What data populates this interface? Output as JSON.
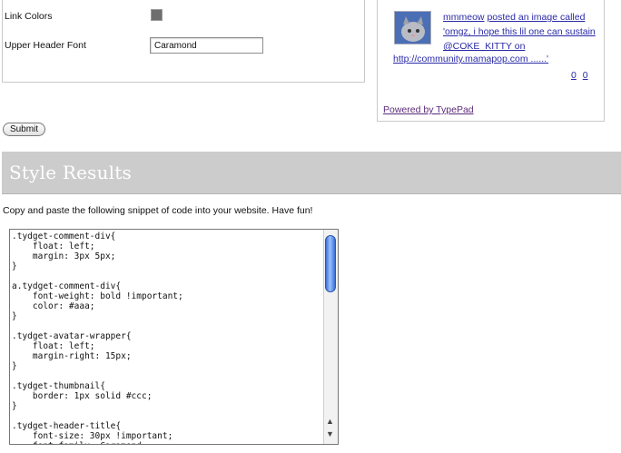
{
  "form": {
    "link_colors_label": "Link Colors",
    "upper_header_font_label": "Upper Header Font",
    "upper_header_font_value": "Caramond",
    "link_color_swatch": "#6e6e6e",
    "submit_label": "Submit"
  },
  "widget": {
    "username": "mmmeow",
    "comment_action": "posted an image called",
    "comment_text": "'omgz, i hope this lil one can sustain @COKE_KITTY on",
    "url_text": "http://community.mamapop.com ......'",
    "pager_left": "0",
    "pager_right": "0",
    "powered_by": "Powered by TypePad"
  },
  "results": {
    "title": "Style Results",
    "instructions": "Copy and paste the following snippet of code into your website. Have fun!",
    "code": ".tydget-comment-div{\n    float: left;\n    margin: 3px 5px;\n}\n\na.tydget-comment-div{\n    font-weight: bold !important;\n    color: #aaa;\n}\n\n.tydget-avatar-wrapper{\n    float: left;\n    margin-right: 15px;\n}\n\n.tydget-thumbnail{\n    border: 1px solid #ccc;\n}\n\n.tydget-header-title{\n    font-size: 30px !important;\n    font-family: Caramond;"
  },
  "colors": {
    "results_bar": "#cccccc",
    "link": "#2a2aa8"
  }
}
